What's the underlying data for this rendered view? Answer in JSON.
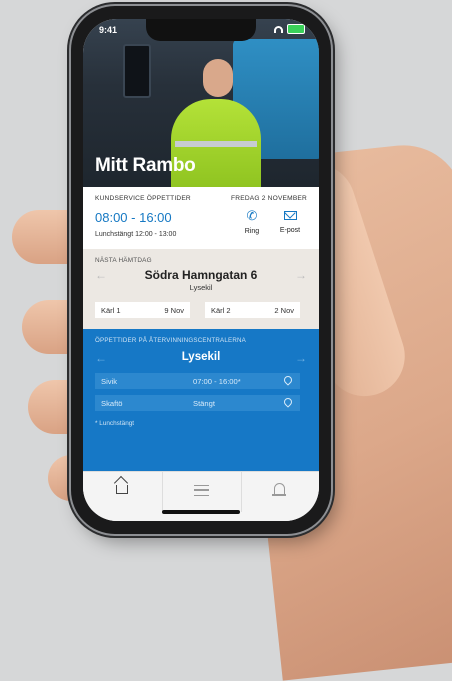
{
  "status_bar": {
    "time": "9:41"
  },
  "header": {
    "title": "Mitt Rambo"
  },
  "customer_service": {
    "label": "KUNDSERVICE ÖPPETTIDER",
    "date": "FREDAG 2 NOVEMBER",
    "hours": "08:00 - 16:00",
    "lunch": "Lunchstängt 12:00 - 13:00",
    "call_label": "Ring",
    "email_label": "E-post"
  },
  "next_pickup": {
    "label": "NÄSTA HÄMTDAG",
    "street": "Södra Hamngatan 6",
    "city": "Lysekil",
    "bins": [
      {
        "name": "Kärl 1",
        "date": "9 Nov"
      },
      {
        "name": "Kärl 2",
        "date": "2 Nov"
      }
    ]
  },
  "recycling": {
    "label": "ÖPPETTIDER PÅ ÅTERVINNINGSCENTRALERNA",
    "city": "Lysekil",
    "rows": [
      {
        "name": "Sivik",
        "hours": "07:00 - 16:00*"
      },
      {
        "name": "Skaftö",
        "hours": "Stängt"
      }
    ],
    "note": "* Lunchstängt"
  },
  "icons": {
    "phone": "phone-icon",
    "email": "envelope-icon",
    "home": "home-icon",
    "menu": "menu-icon",
    "notifications": "bell-icon",
    "location": "map-pin-icon"
  },
  "colors": {
    "accent_blue": "#1578c3",
    "recycling_bg": "#1678c6",
    "pickup_bg": "#ece8e3"
  }
}
